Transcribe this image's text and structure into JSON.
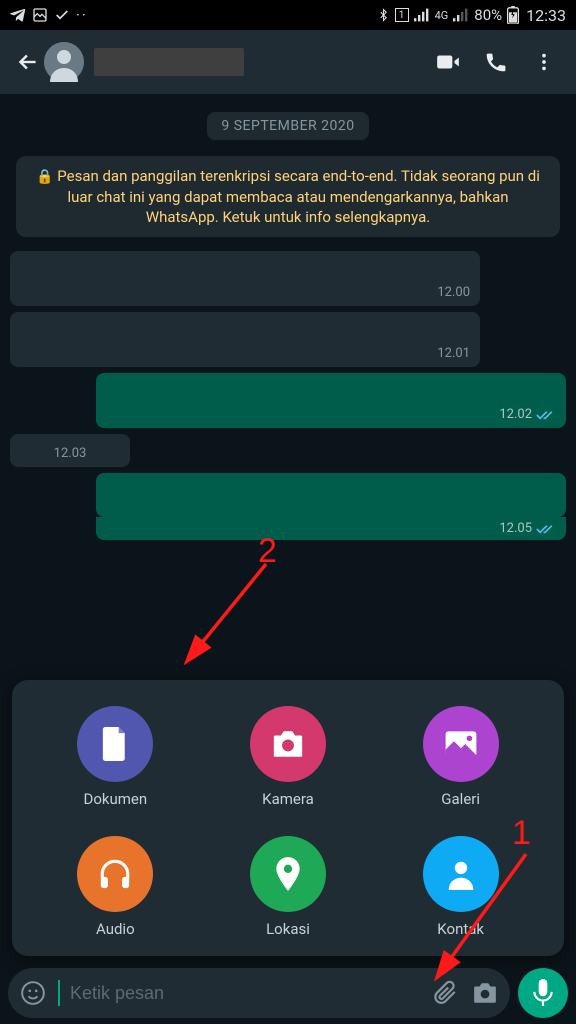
{
  "statusbar": {
    "battery_text": "80%",
    "clock": "12:33",
    "network_label": "4G",
    "sim_slot": "1"
  },
  "header": {
    "contact_name_redacted": ""
  },
  "chat": {
    "date_label": "9 SEPTEMBER 2020",
    "encryption_notice": "Pesan dan panggilan terenkripsi secara end-to-end. Tidak seorang pun di luar chat ini yang dapat membaca atau mendengarkannya, bahkan WhatsApp. Ketuk untuk info selengkapnya.",
    "messages": {
      "m0": {
        "time": "12.00"
      },
      "m1": {
        "time": "12.01"
      },
      "m2": {
        "time": "12.02"
      },
      "m3": {
        "time": "12.03"
      },
      "m4": {
        "time": "12.05"
      }
    }
  },
  "attach": {
    "document": "Dokumen",
    "camera": "Kamera",
    "gallery": "Galeri",
    "audio": "Audio",
    "location": "Lokasi",
    "contact": "Kontak"
  },
  "input": {
    "placeholder": "Ketik pesan"
  },
  "annotations": {
    "one": "1",
    "two": "2"
  }
}
